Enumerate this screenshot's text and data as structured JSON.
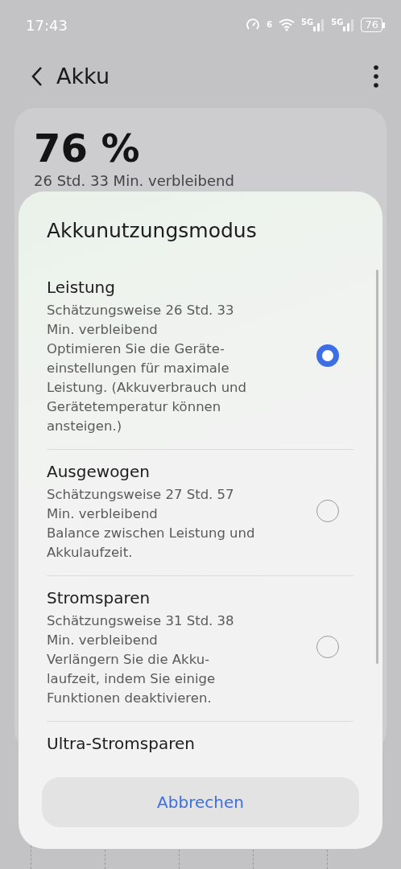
{
  "status_bar": {
    "time": "17:43",
    "wifi_badge": "6",
    "signals": [
      {
        "label": "5G"
      },
      {
        "label": "5G"
      }
    ],
    "battery": "76"
  },
  "header": {
    "title": "Akku"
  },
  "summary": {
    "percent": "76 %",
    "remaining": "26 Std. 33 Min. verbleibend"
  },
  "dialog": {
    "title": "Akkunutzungsmodus",
    "options": [
      {
        "title": "Leistung",
        "estimate": "Schätzungsweise 26 Std. 33 Min. verbleibend",
        "description": "Optimieren Sie die Geräte-einstellungen für maximale Leistung. (Akkuverbrauch und Gerätetemperatur können ansteigen.)",
        "selected": true
      },
      {
        "title": "Ausgewogen",
        "estimate": "Schätzungsweise 27 Std. 57 Min. verbleibend",
        "description": "Balance zwischen Leistung und Akkulaufzeit.",
        "selected": false
      },
      {
        "title": "Stromsparen",
        "estimate": "Schätzungsweise 31 Std. 38 Min. verbleibend",
        "description": "Verlängern Sie die Akku-laufzeit, indem Sie einige Funktionen deaktivieren.",
        "selected": false
      },
      {
        "title": "Ultra-Stromsparen"
      }
    ],
    "cancel": "Abbrechen"
  }
}
